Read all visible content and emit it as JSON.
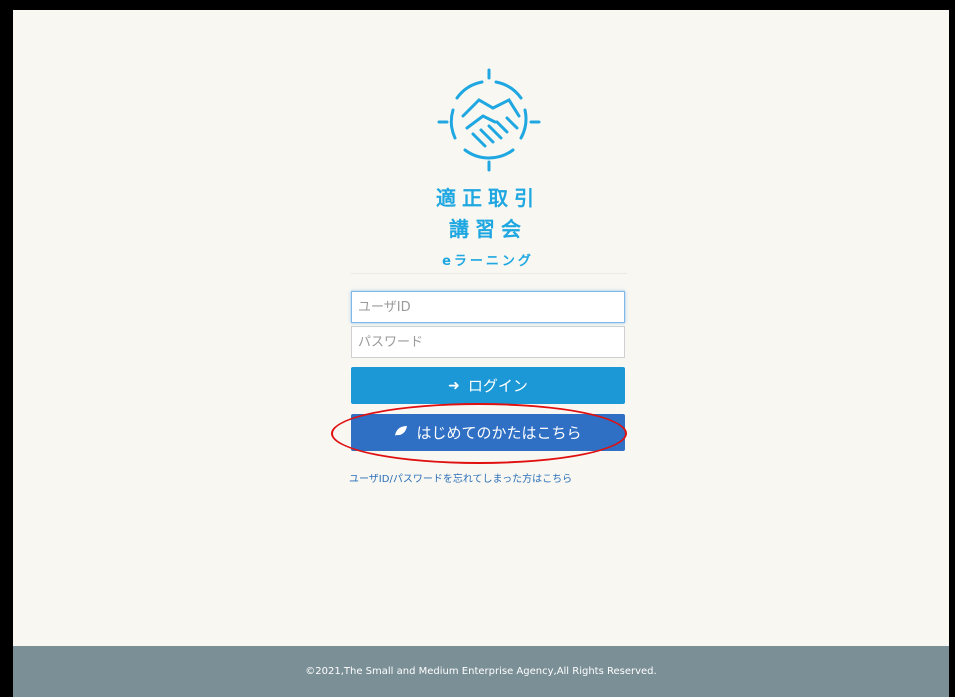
{
  "logo": {
    "line1": "適正取引",
    "line2": "講習会",
    "line3": "eラーニング"
  },
  "form": {
    "userid_placeholder": "ユーザID",
    "password_placeholder": "パスワード",
    "login_label": "ログイン",
    "first_time_label": "はじめてのかたはこちら",
    "forgot_label": "ユーザID/パスワードを忘れてしまった方はこちら"
  },
  "footer": {
    "copyright": "©2021,The Small and Medium Enterprise Agency,All Rights Reserved."
  },
  "icons": {
    "logo": "handshake-icon",
    "login": "sign-in-icon",
    "first_time": "leaf-icon"
  },
  "colors": {
    "brand": "#1ea7e1",
    "login_button": "#1b98d5",
    "first_time_button": "#2f6fc4",
    "footer": "#7b8f96",
    "annotation": "#e01010"
  }
}
